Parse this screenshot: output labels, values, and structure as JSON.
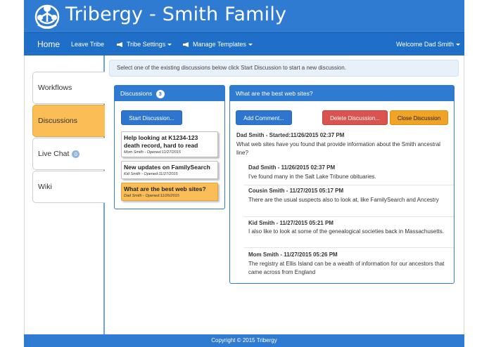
{
  "header": {
    "title": "Tribergy - Smith Family",
    "logo": "family-tree-logo-icon"
  },
  "nav": {
    "home": "Home",
    "leave": "Leave Tribe",
    "settings": "Tribe Settings",
    "templates": "Manage Templates",
    "welcome": "Welcome Dad Smith",
    "megaphone_icon": "megaphone-icon"
  },
  "sidebar": {
    "items": [
      {
        "label": "Workflows",
        "badge": ""
      },
      {
        "label": "Discussions",
        "badge": ""
      },
      {
        "label": "Live Chat",
        "badge": "0"
      },
      {
        "label": "Wiki",
        "badge": ""
      }
    ],
    "active": "Discussions"
  },
  "info": "Select one of the existing discussions below click Start Discussion to start a new discussion.",
  "discussions": {
    "title": "Discussions",
    "count": "3",
    "start_button": "Start Discussion...",
    "items": [
      {
        "title": "Help looking at K1234-123 death record, hard to read",
        "meta": "Mom Smith - Opened:11/27/2015"
      },
      {
        "title": "New updates on FamilySearch",
        "meta": "Kid Smith - Opened:11/27/2015"
      },
      {
        "title": "What are the best web sites?",
        "meta": "Dad Smith - Opened:11/26/2015"
      }
    ]
  },
  "thread": {
    "title": "What are the best web sites?",
    "add_button": "Add Comment...",
    "delete_button": "Delete Discussion...",
    "close_button": "Close Discussion",
    "starter": {
      "head": "Dad Smith - Started:11/26/2015 02:37 PM",
      "body": "What web sites have you found that provide information about the Smith ancestral line?"
    },
    "replies": [
      {
        "head": "Dad Smith - 11/26/2015 02:37 PM",
        "body": "I've found many in the Salt Lake Tribune obituaries."
      },
      {
        "head": "Cousin Smith - 11/27/2015 05:17 PM",
        "body": "There are the usual suspects also to look at, like FamilySearch and Ancestry"
      },
      {
        "head": "Kid Smith - 11/27/2015 05:21 PM",
        "body": "I also like to look at some of the genealogical societies back in Massachusetts."
      },
      {
        "head": "Mom Smith - 11/27/2015 05:26 PM",
        "body": "The registry at Ellis Island can be a wealth of information for our ancestors that came across from England"
      }
    ]
  },
  "footer": "Copyright © 2015 Tribergy",
  "colors": {
    "primary": "#2f7bd2",
    "active": "#fbbd55",
    "danger": "#d9534f",
    "warning": "#f1a325"
  }
}
